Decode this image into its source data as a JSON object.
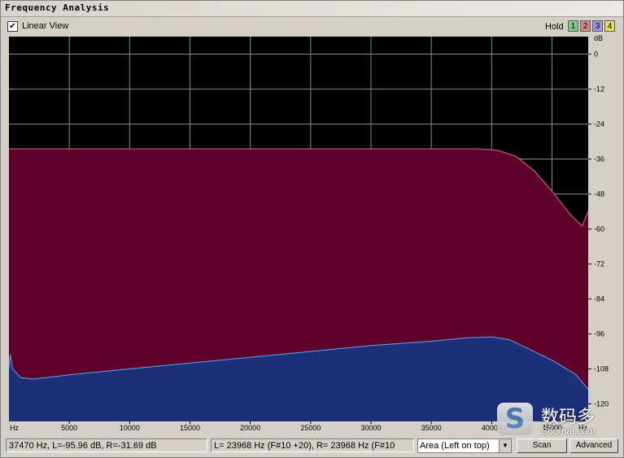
{
  "window": {
    "title": "Frequency Analysis"
  },
  "toolbar": {
    "linear_view_label": "Linear View",
    "linear_view_checked": true,
    "hold_label": "Hold",
    "hold_buttons": [
      {
        "label": "1",
        "color": "#86c886"
      },
      {
        "label": "2",
        "color": "#d88888"
      },
      {
        "label": "3",
        "color": "#9898d8"
      },
      {
        "label": "4",
        "color": "#e0e060"
      }
    ]
  },
  "chart_data": {
    "type": "area",
    "x_unit": "Hz",
    "y_unit": "dB",
    "xlim": [
      0,
      48000
    ],
    "ylim": [
      -126,
      6
    ],
    "x_ticks": [
      5000,
      10000,
      15000,
      20000,
      25000,
      30000,
      35000,
      40000,
      45000
    ],
    "x_tick_labels": [
      "Hz",
      "5000",
      "10000",
      "15000",
      "20000",
      "25000",
      "30000",
      "35000",
      "40000",
      "45000",
      "Hz"
    ],
    "y_ticks": [
      0,
      -12,
      -24,
      -36,
      -48,
      -60,
      -72,
      -84,
      -96,
      -108,
      -120
    ],
    "y_tick_labels": [
      "dB",
      "0",
      "-12",
      "-24",
      "-36",
      "-48",
      "-60",
      "-72",
      "-84",
      "-96",
      "-108",
      "-120"
    ],
    "grid": true,
    "series": [
      {
        "color": "#5e002c",
        "line_color": "#e060a0",
        "points": [
          [
            0,
            -32.5
          ],
          [
            5000,
            -32.5
          ],
          [
            10000,
            -32.5
          ],
          [
            15000,
            -32.5
          ],
          [
            20000,
            -32.5
          ],
          [
            25000,
            -32.5
          ],
          [
            30000,
            -32.5
          ],
          [
            35000,
            -32.5
          ],
          [
            39000,
            -32.5
          ],
          [
            40500,
            -33
          ],
          [
            42000,
            -35
          ],
          [
            43500,
            -40
          ],
          [
            45000,
            -47
          ],
          [
            46500,
            -55
          ],
          [
            47500,
            -59
          ],
          [
            48000,
            -54
          ]
        ]
      },
      {
        "color": "#1e2f7a",
        "line_color": "#5aa8e8",
        "points": [
          [
            0,
            -108
          ],
          [
            100,
            -103
          ],
          [
            300,
            -108
          ],
          [
            1000,
            -111
          ],
          [
            2000,
            -111.5
          ],
          [
            5000,
            -110
          ],
          [
            10000,
            -108
          ],
          [
            15000,
            -106
          ],
          [
            20000,
            -104
          ],
          [
            25000,
            -102
          ],
          [
            30000,
            -100
          ],
          [
            35000,
            -98.5
          ],
          [
            38000,
            -97.3
          ],
          [
            40000,
            -97
          ],
          [
            41500,
            -98
          ],
          [
            43000,
            -101
          ],
          [
            45000,
            -105
          ],
          [
            47000,
            -110
          ],
          [
            48000,
            -115
          ]
        ]
      }
    ]
  },
  "status": {
    "readout_left": "37470 Hz, L=-95.96 dB, R=-31.69 dB",
    "readout_right": "L=  23968 Hz (F#10 +20), R=  23968 Hz (F#10",
    "mode_select": "Area (Left on top)",
    "scan_label": "Scan",
    "advanced_label": "Advanced"
  },
  "watermark": {
    "cn": "数码多",
    "en": "Soomal.com",
    "logo": "S"
  }
}
